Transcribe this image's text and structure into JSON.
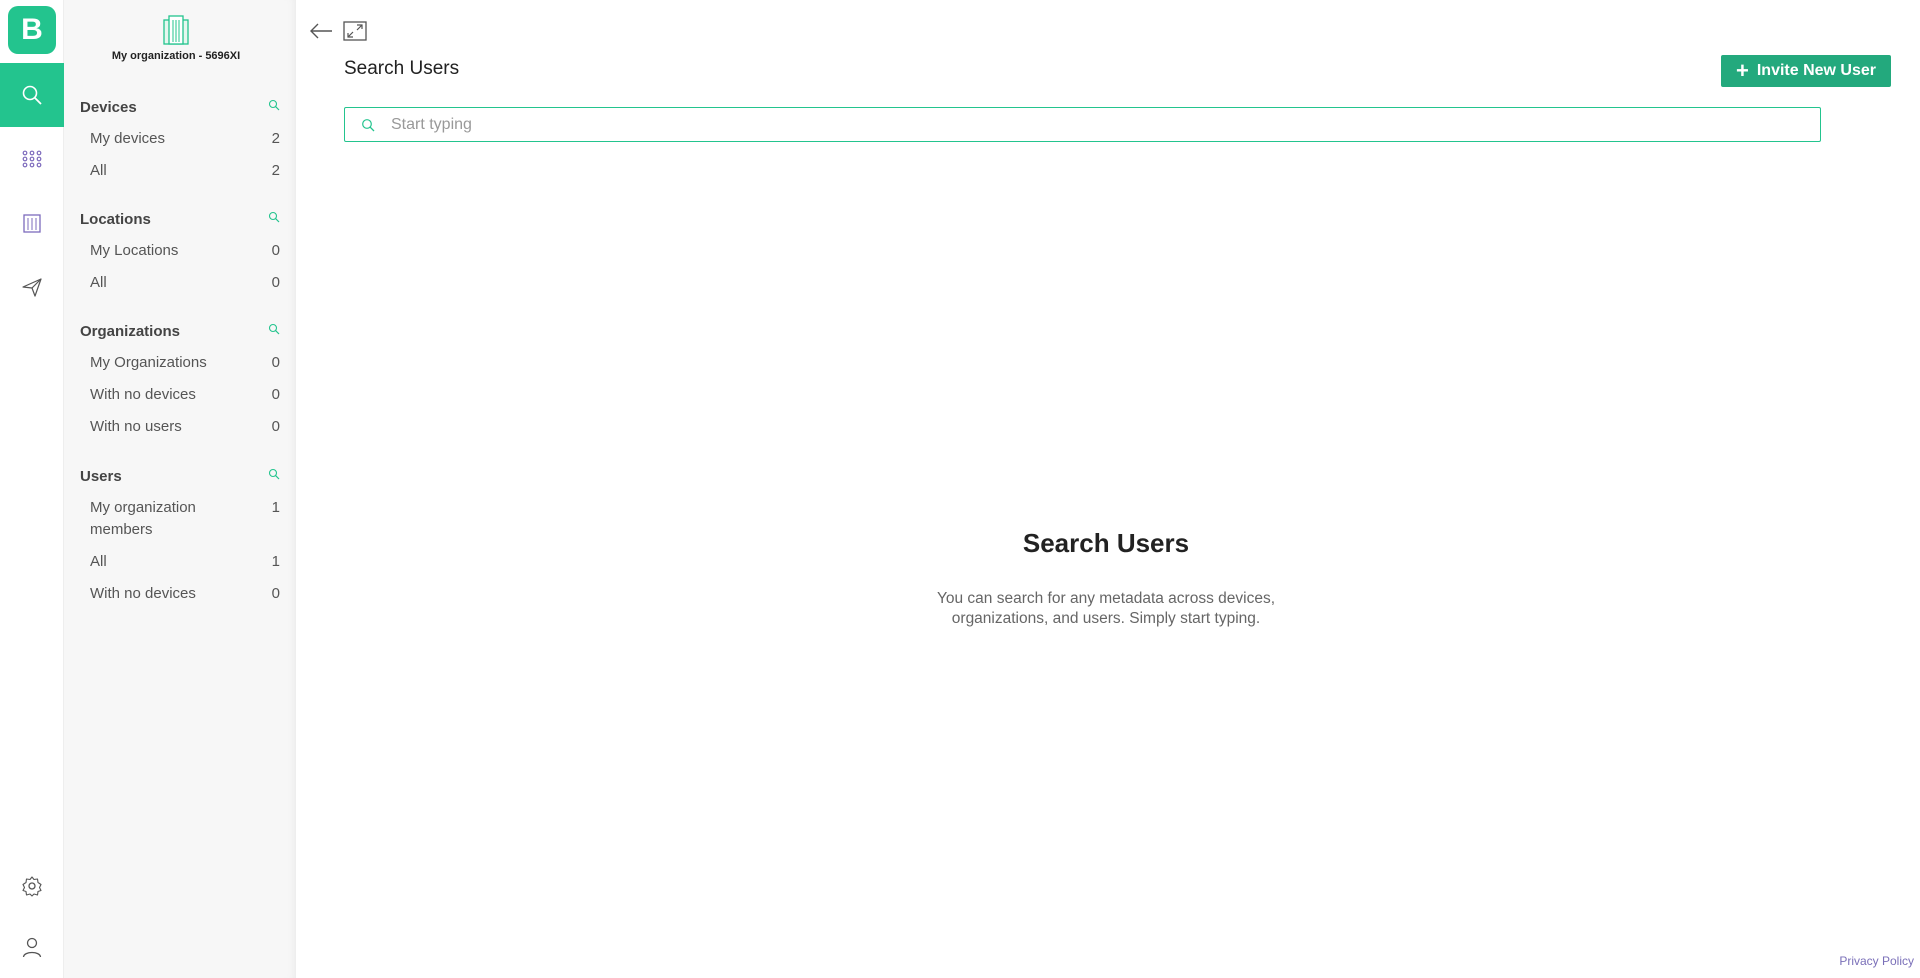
{
  "rail": {
    "logo_letter": "B",
    "brand_color": "#23c48e",
    "items": [
      {
        "icon": "search-icon"
      },
      {
        "icon": "grid-icon"
      },
      {
        "icon": "building-icon"
      },
      {
        "icon": "send-icon"
      }
    ],
    "bottom": [
      {
        "icon": "settings-icon"
      },
      {
        "icon": "user-icon"
      }
    ]
  },
  "sidebar": {
    "org_name": "My organization - 5696XI",
    "sections": [
      {
        "title": "Devices",
        "items": [
          {
            "label": "My devices",
            "count": "2"
          },
          {
            "label": "All",
            "count": "2"
          }
        ]
      },
      {
        "title": "Locations",
        "items": [
          {
            "label": "My Locations",
            "count": "0"
          },
          {
            "label": "All",
            "count": "0"
          }
        ]
      },
      {
        "title": "Organizations",
        "items": [
          {
            "label": "My Organizations",
            "count": "0"
          },
          {
            "label": "With no devices",
            "count": "0"
          },
          {
            "label": "With no users",
            "count": "0"
          }
        ]
      },
      {
        "title": "Users",
        "items": [
          {
            "label": "My organization members",
            "count": "1"
          },
          {
            "label": "All",
            "count": "1"
          },
          {
            "label": "With no devices",
            "count": "0"
          }
        ]
      }
    ]
  },
  "main": {
    "title": "Search Users",
    "invite_label": "Invite New User",
    "search_placeholder": "Start typing",
    "empty_title": "Search Users",
    "empty_text": "You can search for any metadata across devices, organizations, and users. Simply start typing."
  },
  "footer": {
    "privacy_label": "Privacy Policy"
  },
  "colors": {
    "accent": "#23c48e",
    "button": "#23a97d",
    "link": "#7a6fb8"
  }
}
